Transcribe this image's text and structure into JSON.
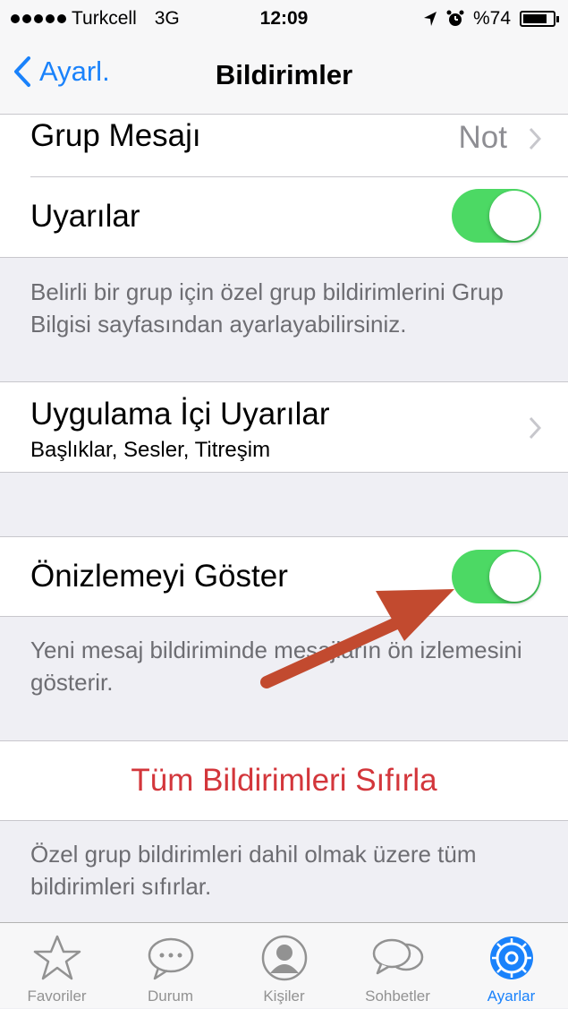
{
  "status_bar": {
    "carrier": "Turkcell",
    "network": "3G",
    "time": "12:09",
    "battery": "%74"
  },
  "nav": {
    "back_label": "Ayarl.",
    "title": "Bildirimler"
  },
  "rows": {
    "group_message": {
      "label": "Grup Mesajı",
      "value": "Not"
    },
    "alerts": {
      "label": "Uyarılar",
      "on": true
    },
    "alerts_footer": "Belirli bir grup için özel grup bildirimlerini Grup Bilgisi sayfasından ayarlayabilirsiniz.",
    "in_app": {
      "label": "Uygulama İçi Uyarılar",
      "subtitle": "Başlıklar, Sesler, Titreşim"
    },
    "preview": {
      "label": "Önizlemeyi Göster",
      "on": true
    },
    "preview_footer": "Yeni mesaj bildiriminde mesajların ön izlemesini gösterir.",
    "reset": {
      "label": "Tüm Bildirimleri Sıfırla"
    },
    "reset_footer": "Özel grup bildirimleri dahil olmak üzere tüm bildirimleri sıfırlar."
  },
  "tabs": [
    {
      "label": "Favoriler",
      "icon": "star-icon"
    },
    {
      "label": "Durum",
      "icon": "speech-bubble-icon"
    },
    {
      "label": "Kişiler",
      "icon": "person-icon"
    },
    {
      "label": "Sohbetler",
      "icon": "chats-icon"
    },
    {
      "label": "Ayarlar",
      "icon": "gear-icon",
      "active": true
    }
  ],
  "colors": {
    "accent": "#1a82fb",
    "toggle_on": "#4cd964",
    "destructive": "#d3363b",
    "annotation_arrow": "#c24a2f"
  }
}
